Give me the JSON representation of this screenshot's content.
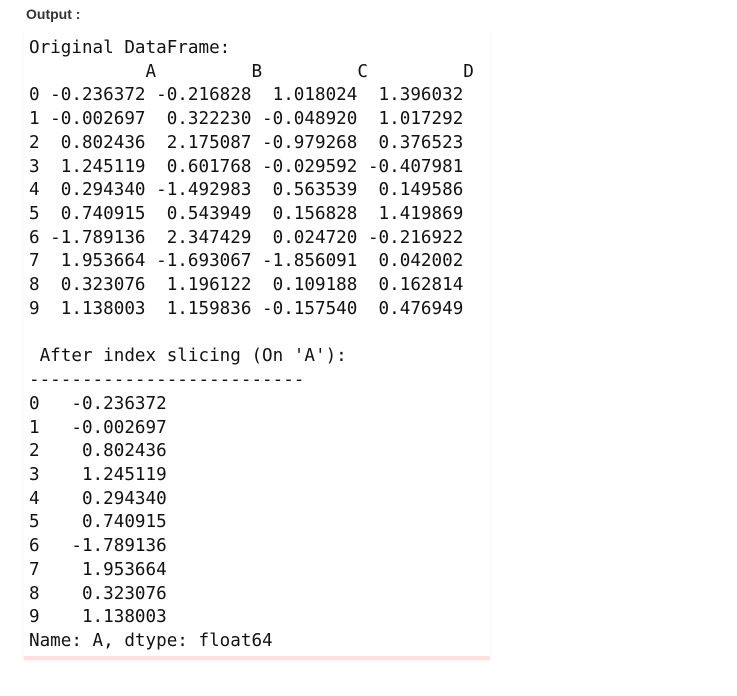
{
  "output_label": "Output :",
  "output_lines": [
    "Original DataFrame:",
    "           A         B         C         D",
    "0 -0.236372 -0.216828  1.018024  1.396032",
    "1 -0.002697  0.322230 -0.048920  1.017292",
    "2  0.802436  2.175087 -0.979268  0.376523",
    "3  1.245119  0.601768 -0.029592 -0.407981",
    "4  0.294340 -1.492983  0.563539  0.149586",
    "5  0.740915  0.543949  0.156828  1.419869",
    "6 -1.789136  2.347429  0.024720 -0.216922",
    "7  1.953664 -1.693067 -1.856091  0.042002",
    "8  0.323076  1.196122  0.109188  0.162814",
    "9  1.138003  1.159836 -0.157540  0.476949",
    "",
    " After index slicing (On 'A'):",
    "--------------------------",
    "0   -0.236372",
    "1   -0.002697",
    "2    0.802436",
    "3    1.245119",
    "4    0.294340",
    "5    0.740915",
    "6   -1.789136",
    "7    1.953664",
    "8    0.323076",
    "9    1.138003",
    "Name: A, dtype: float64"
  ]
}
